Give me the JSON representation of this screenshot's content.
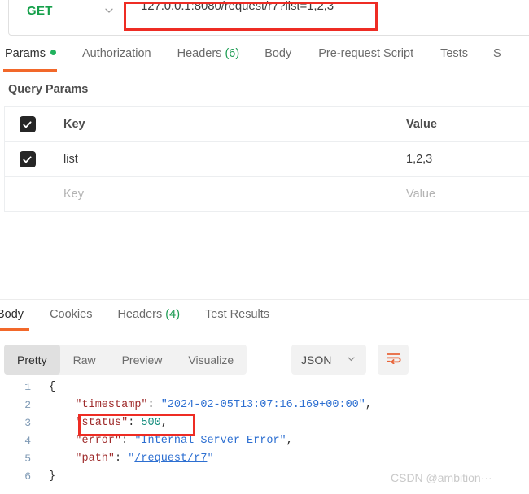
{
  "request": {
    "method": "GET",
    "method_caret_icon": "chevron-down-icon",
    "url": "127.0.0.1:8080/request/r7?list=1,2,3",
    "url_highlight_color": "#ee2c24",
    "method_color": "#16a04b"
  },
  "request_tabs": [
    {
      "label": "Params",
      "active": true,
      "dot": true,
      "count": ""
    },
    {
      "label": "Authorization",
      "active": false,
      "dot": false,
      "count": ""
    },
    {
      "label": "Headers",
      "active": false,
      "dot": false,
      "count": "(6)"
    },
    {
      "label": "Body",
      "active": false,
      "dot": false,
      "count": ""
    },
    {
      "label": "Pre-request Script",
      "active": false,
      "dot": false,
      "count": ""
    },
    {
      "label": "Tests",
      "active": false,
      "dot": false,
      "count": ""
    },
    {
      "label": "S",
      "active": false,
      "dot": false,
      "count": ""
    }
  ],
  "query_params": {
    "section_title": "Query Params",
    "columns": [
      "Key",
      "Value"
    ],
    "header_checkbox_checked": true,
    "rows": [
      {
        "checked": true,
        "key": "list",
        "value": "1,2,3",
        "placeholder_row": false
      },
      {
        "checked": false,
        "key": "Key",
        "value": "Value",
        "placeholder_row": true
      }
    ]
  },
  "response_tabs": [
    {
      "label": "Body",
      "active": true,
      "count": ""
    },
    {
      "label": "Cookies",
      "active": false,
      "count": ""
    },
    {
      "label": "Headers",
      "active": false,
      "count": "(4)"
    },
    {
      "label": "Test Results",
      "active": false,
      "count": ""
    }
  ],
  "response_toolbar": {
    "view_modes": [
      {
        "label": "Pretty",
        "active": true
      },
      {
        "label": "Raw",
        "active": false
      },
      {
        "label": "Preview",
        "active": false
      },
      {
        "label": "Visualize",
        "active": false
      }
    ],
    "format": "JSON",
    "format_caret_icon": "chevron-down-icon",
    "wrap_icon": "wrap-lines-icon",
    "wrap_icon_color": "#e8653a"
  },
  "response_body": {
    "line_numbers": [
      "1",
      "2",
      "3",
      "4",
      "5",
      "6"
    ],
    "lines": [
      {
        "segments": [
          {
            "t": "{",
            "c": "br"
          }
        ]
      },
      {
        "segments": [
          {
            "t": "    ",
            "c": "p"
          },
          {
            "t": "\"timestamp\"",
            "c": "k"
          },
          {
            "t": ": ",
            "c": "p"
          },
          {
            "t": "\"2024-02-05T13:07:16.169+00:00\"",
            "c": "s"
          },
          {
            "t": ",",
            "c": "p"
          }
        ]
      },
      {
        "segments": [
          {
            "t": "    ",
            "c": "p"
          },
          {
            "t": "\"status\"",
            "c": "k"
          },
          {
            "t": ": ",
            "c": "p"
          },
          {
            "t": "500",
            "c": "n"
          },
          {
            "t": ",",
            "c": "p"
          }
        ]
      },
      {
        "segments": [
          {
            "t": "    ",
            "c": "p"
          },
          {
            "t": "\"error\"",
            "c": "k"
          },
          {
            "t": ": ",
            "c": "p"
          },
          {
            "t": "\"Internal Server Error\"",
            "c": "s"
          },
          {
            "t": ",",
            "c": "p"
          }
        ]
      },
      {
        "segments": [
          {
            "t": "    ",
            "c": "p"
          },
          {
            "t": "\"path\"",
            "c": "k"
          },
          {
            "t": ": ",
            "c": "p"
          },
          {
            "t": "\"",
            "c": "s"
          },
          {
            "t": "/request/r7",
            "c": "link"
          },
          {
            "t": "\"",
            "c": "s"
          }
        ]
      },
      {
        "segments": [
          {
            "t": "}",
            "c": "br"
          }
        ]
      }
    ],
    "highlight_box": {
      "text": "\"status\": 500,",
      "color": "#ee2c24"
    }
  },
  "watermark": "CSDN @ambition···"
}
